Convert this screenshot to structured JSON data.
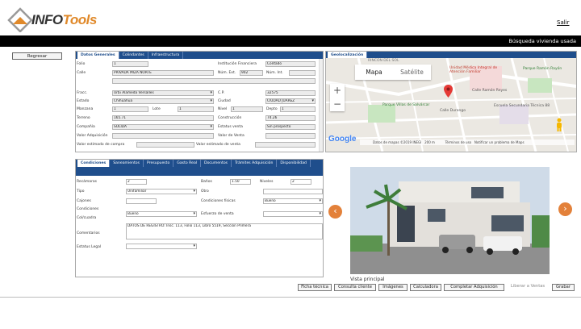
{
  "header": {
    "logo_info": "INFO",
    "logo_tools": "Tools",
    "salir": "Salir",
    "title": "Búsqueda vivienda usada"
  },
  "regresar": "Regresar",
  "datos": {
    "tabs": [
      "Datos Generales",
      "Colindantes",
      "Infraestructura"
    ],
    "folio_label": "Folio",
    "folio": "1",
    "calle_label": "Calle",
    "calle": "PRIVADA MIZA NORTE",
    "inst_label": "Institución Financiera",
    "inst": "Contado",
    "ext_label": "Núm. Ext.",
    "ext": "902",
    "int_label": "Núm. Int.",
    "int": "",
    "fracc_label": "Fracc.",
    "fracc": "Urbi Alameda Versalles",
    "cp_label": "C.P.",
    "cp": "32575",
    "estado_label": "Estado",
    "estado": "Chihuahua",
    "ciudad_label": "Ciudad",
    "ciudad": "CIUDAD JUAREZ",
    "manzana_label": "Manzana",
    "manzana": "1",
    "lote_label": "Lote",
    "lote": "1",
    "nivel_label": "Nivel",
    "nivel": "1",
    "depto_label": "Depto",
    "depto": "1",
    "terreno_label": "Terreno",
    "terreno": "165.71",
    "construccion_label": "Construcción",
    "construccion": "74.26",
    "compania_label": "Compañía",
    "compania": "SOLIDA",
    "estatus_label": "Estatus venta",
    "estatus": "Sin prospecto",
    "valor_adq_label": "Valor Adquisición",
    "valor_adq": "",
    "valor_venta_label": "Valor de Venta",
    "valor_venta": "",
    "valor_est_compra_label": "Valor estimado de compra",
    "valor_est_compra": "",
    "valor_est_venta_label": "Valor estimado de venta",
    "valor_est_venta": ""
  },
  "geo": {
    "tab": "Geolocalización",
    "mapa": "Mapa",
    "satelite": "Satélite",
    "labels": [
      "Unidad Médica Integral de Atención Familiar",
      "Parque Ramón Rayón",
      "Calle Ramón Reyes",
      "Escuela Secundaria Técnica 88",
      "Parque Villas de Salvárcar",
      "Calle Durango",
      "RINCÓN DEL SOL"
    ],
    "google": "Google",
    "footer": "Datos de mapas ©2019 INEGI   200 m          Términos de uso   Notificar un problema de Maps"
  },
  "cond": {
    "tabs": [
      "Condiciones",
      "Saneamientos",
      "Presupuesto",
      "Gasto Real",
      "Documentos",
      "Trámites Adquisición",
      "Disponibilidad"
    ],
    "recamaras_label": "Recámaras",
    "recamaras": "2",
    "banos_label": "Baños",
    "banos": "1.50",
    "niveles_label": "Niveles",
    "niveles": "2",
    "tipo_label": "Tipo",
    "tipo": "Unifamiliar",
    "otro_label": "Otro",
    "otro": "",
    "cajones_label": "Cajones",
    "cajones": "",
    "cond_fisicas_label": "Condiciones físicas",
    "cond_fisicas": "Bueno",
    "condiciones_label": "Condiciones",
    "condiciones": "Bueno",
    "colcuadra_label": "Col/cuadra",
    "esfuerzo_label": "Esfuerzo de venta",
    "esfuerzo": "",
    "comentarios_label": "Comentarios",
    "comentarios": "DATOS DE REGISTRO: Insc. 113, Folio 113, Libro 5519, Sección Primera",
    "estatus_legal_label": "Estatus Legal",
    "estatus_legal": ""
  },
  "gallery": {
    "caption": "Vista principal",
    "prev": "‹",
    "next": "›"
  },
  "buttons": [
    "Ficha técnica",
    "Consulta cliente",
    "Imágenes",
    "Calculadora",
    "Completar Adquisición",
    "Liberar a Ventas",
    "Grabar"
  ]
}
